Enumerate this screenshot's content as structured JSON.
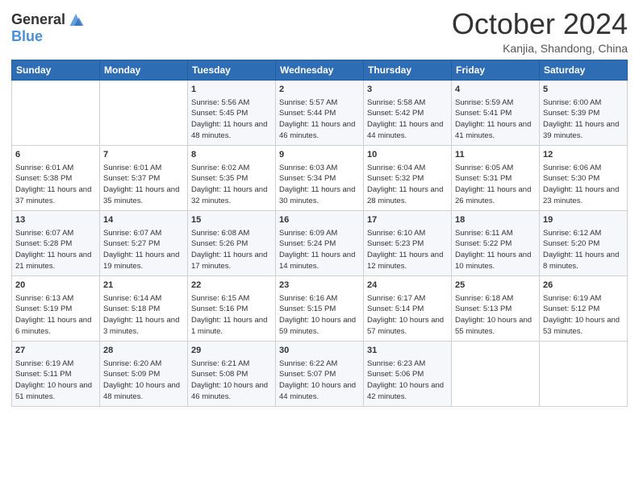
{
  "header": {
    "logo_line1": "General",
    "logo_line2": "Blue",
    "month": "October 2024",
    "location": "Kanjia, Shandong, China"
  },
  "weekdays": [
    "Sunday",
    "Monday",
    "Tuesday",
    "Wednesday",
    "Thursday",
    "Friday",
    "Saturday"
  ],
  "weeks": [
    [
      {
        "day": "",
        "empty": true
      },
      {
        "day": "",
        "empty": true
      },
      {
        "day": "1",
        "sunrise": "5:56 AM",
        "sunset": "5:45 PM",
        "daylight": "11 hours and 48 minutes."
      },
      {
        "day": "2",
        "sunrise": "5:57 AM",
        "sunset": "5:44 PM",
        "daylight": "11 hours and 46 minutes."
      },
      {
        "day": "3",
        "sunrise": "5:58 AM",
        "sunset": "5:42 PM",
        "daylight": "11 hours and 44 minutes."
      },
      {
        "day": "4",
        "sunrise": "5:59 AM",
        "sunset": "5:41 PM",
        "daylight": "11 hours and 41 minutes."
      },
      {
        "day": "5",
        "sunrise": "6:00 AM",
        "sunset": "5:39 PM",
        "daylight": "11 hours and 39 minutes."
      }
    ],
    [
      {
        "day": "6",
        "sunrise": "6:01 AM",
        "sunset": "5:38 PM",
        "daylight": "11 hours and 37 minutes."
      },
      {
        "day": "7",
        "sunrise": "6:01 AM",
        "sunset": "5:37 PM",
        "daylight": "11 hours and 35 minutes."
      },
      {
        "day": "8",
        "sunrise": "6:02 AM",
        "sunset": "5:35 PM",
        "daylight": "11 hours and 32 minutes."
      },
      {
        "day": "9",
        "sunrise": "6:03 AM",
        "sunset": "5:34 PM",
        "daylight": "11 hours and 30 minutes."
      },
      {
        "day": "10",
        "sunrise": "6:04 AM",
        "sunset": "5:32 PM",
        "daylight": "11 hours and 28 minutes."
      },
      {
        "day": "11",
        "sunrise": "6:05 AM",
        "sunset": "5:31 PM",
        "daylight": "11 hours and 26 minutes."
      },
      {
        "day": "12",
        "sunrise": "6:06 AM",
        "sunset": "5:30 PM",
        "daylight": "11 hours and 23 minutes."
      }
    ],
    [
      {
        "day": "13",
        "sunrise": "6:07 AM",
        "sunset": "5:28 PM",
        "daylight": "11 hours and 21 minutes."
      },
      {
        "day": "14",
        "sunrise": "6:07 AM",
        "sunset": "5:27 PM",
        "daylight": "11 hours and 19 minutes."
      },
      {
        "day": "15",
        "sunrise": "6:08 AM",
        "sunset": "5:26 PM",
        "daylight": "11 hours and 17 minutes."
      },
      {
        "day": "16",
        "sunrise": "6:09 AM",
        "sunset": "5:24 PM",
        "daylight": "11 hours and 14 minutes."
      },
      {
        "day": "17",
        "sunrise": "6:10 AM",
        "sunset": "5:23 PM",
        "daylight": "11 hours and 12 minutes."
      },
      {
        "day": "18",
        "sunrise": "6:11 AM",
        "sunset": "5:22 PM",
        "daylight": "11 hours and 10 minutes."
      },
      {
        "day": "19",
        "sunrise": "6:12 AM",
        "sunset": "5:20 PM",
        "daylight": "11 hours and 8 minutes."
      }
    ],
    [
      {
        "day": "20",
        "sunrise": "6:13 AM",
        "sunset": "5:19 PM",
        "daylight": "11 hours and 6 minutes."
      },
      {
        "day": "21",
        "sunrise": "6:14 AM",
        "sunset": "5:18 PM",
        "daylight": "11 hours and 3 minutes."
      },
      {
        "day": "22",
        "sunrise": "6:15 AM",
        "sunset": "5:16 PM",
        "daylight": "11 hours and 1 minute."
      },
      {
        "day": "23",
        "sunrise": "6:16 AM",
        "sunset": "5:15 PM",
        "daylight": "10 hours and 59 minutes."
      },
      {
        "day": "24",
        "sunrise": "6:17 AM",
        "sunset": "5:14 PM",
        "daylight": "10 hours and 57 minutes."
      },
      {
        "day": "25",
        "sunrise": "6:18 AM",
        "sunset": "5:13 PM",
        "daylight": "10 hours and 55 minutes."
      },
      {
        "day": "26",
        "sunrise": "6:19 AM",
        "sunset": "5:12 PM",
        "daylight": "10 hours and 53 minutes."
      }
    ],
    [
      {
        "day": "27",
        "sunrise": "6:19 AM",
        "sunset": "5:11 PM",
        "daylight": "10 hours and 51 minutes."
      },
      {
        "day": "28",
        "sunrise": "6:20 AM",
        "sunset": "5:09 PM",
        "daylight": "10 hours and 48 minutes."
      },
      {
        "day": "29",
        "sunrise": "6:21 AM",
        "sunset": "5:08 PM",
        "daylight": "10 hours and 46 minutes."
      },
      {
        "day": "30",
        "sunrise": "6:22 AM",
        "sunset": "5:07 PM",
        "daylight": "10 hours and 44 minutes."
      },
      {
        "day": "31",
        "sunrise": "6:23 AM",
        "sunset": "5:06 PM",
        "daylight": "10 hours and 42 minutes."
      },
      {
        "day": "",
        "empty": true
      },
      {
        "day": "",
        "empty": true
      }
    ]
  ]
}
